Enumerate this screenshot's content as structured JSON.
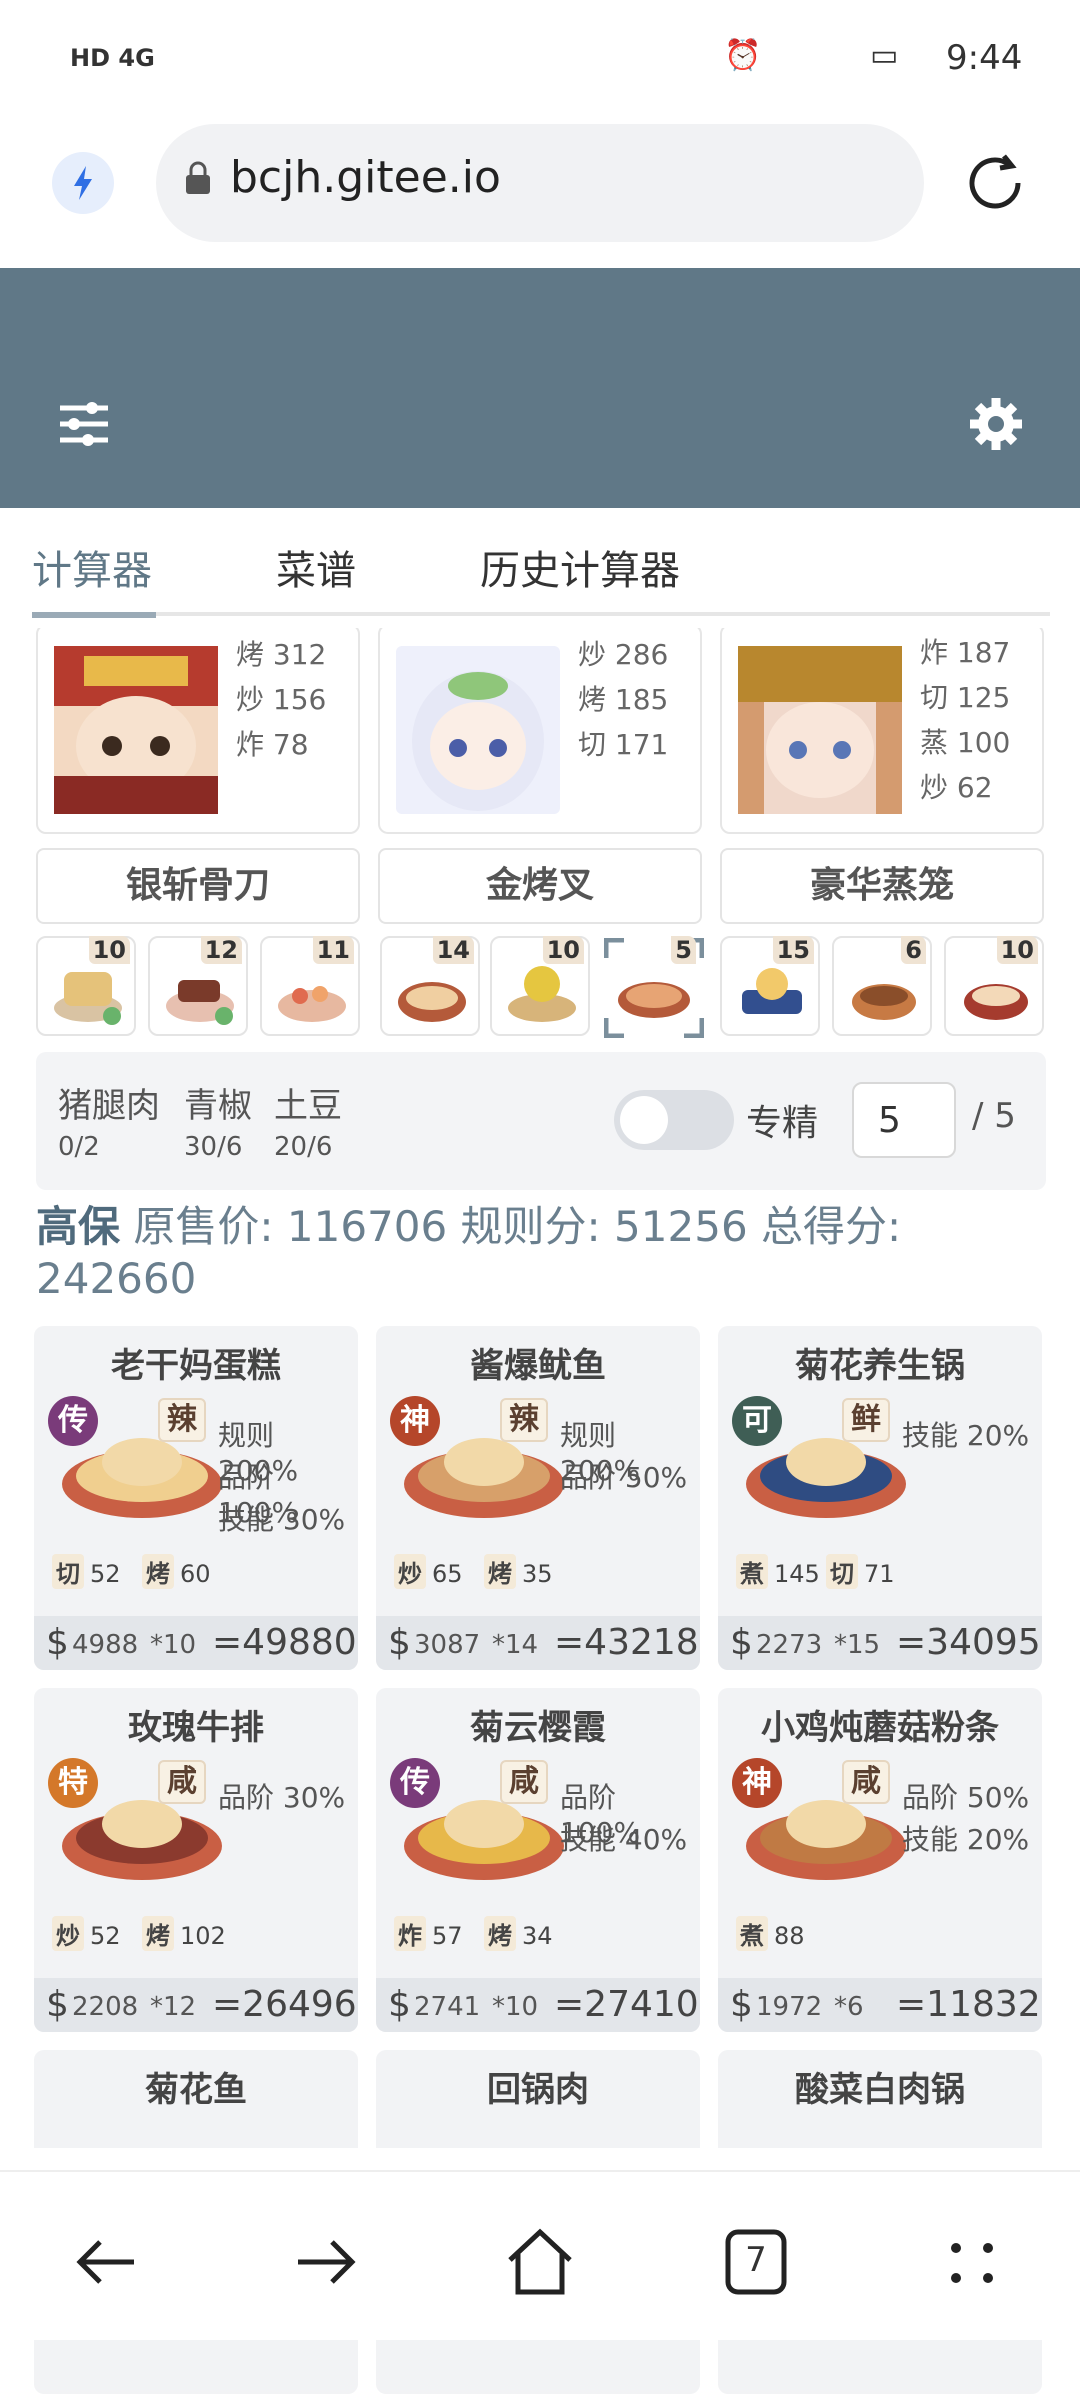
{
  "status": {
    "left": "HD 4G",
    "time": "9:44"
  },
  "url": "bcjh.gitee.io",
  "tabs": [
    "计算器",
    "菜谱",
    "历史计算器"
  ],
  "chefs": [
    {
      "skills": [
        "烤 312",
        "炒 156",
        "炸 78"
      ]
    },
    {
      "skills": [
        "炒 286",
        "烤 185",
        "切 171"
      ]
    },
    {
      "skills": [
        "炸 187",
        "切 125",
        "蒸 100",
        "炒 62"
      ]
    }
  ],
  "tools": [
    "银斩骨刀",
    "金烤叉",
    "豪华蒸笼"
  ],
  "slots": [
    "10",
    "12",
    "11",
    "14",
    "10",
    "5",
    "15",
    "6",
    "10"
  ],
  "ingredients": [
    {
      "name": "猪腿肉",
      "qty": "0/2"
    },
    {
      "name": "青椒",
      "qty": "30/6"
    },
    {
      "name": "土豆",
      "qty": "20/6"
    }
  ],
  "expert": {
    "label": "专精",
    "value": "5",
    "max": "/ 5"
  },
  "summary": {
    "dish": "高保",
    "line1": "原售价: 116706 规则分: 51256 总得分:",
    "line2": "242660"
  },
  "dishes": [
    {
      "name": "老干妈蛋糕",
      "rank": "传",
      "flavor": "辣",
      "bonus": [
        "规则 200%",
        "品阶 100%",
        "技能 30%"
      ],
      "skills": [
        [
          "切",
          "52"
        ],
        [
          "烤",
          "60"
        ]
      ],
      "price": "4988",
      "mult": "*10",
      "total": "=49880"
    },
    {
      "name": "酱爆鱿鱼",
      "rank": "神",
      "flavor": "辣",
      "bonus": [
        "规则 200%",
        "品阶 50%"
      ],
      "skills": [
        [
          "炒",
          "65"
        ],
        [
          "烤",
          "35"
        ]
      ],
      "price": "3087",
      "mult": "*14",
      "total": "=43218"
    },
    {
      "name": "菊花养生锅",
      "rank": "可",
      "flavor": "鲜",
      "bonus": [
        "技能 20%"
      ],
      "skills": [
        [
          "煮",
          "145"
        ],
        [
          "切",
          "71"
        ]
      ],
      "price": "2273",
      "mult": "*15",
      "total": "=34095"
    },
    {
      "name": "玫瑰牛排",
      "rank": "特",
      "flavor": "咸",
      "bonus": [
        "品阶 30%"
      ],
      "skills": [
        [
          "炒",
          "52"
        ],
        [
          "烤",
          "102"
        ]
      ],
      "price": "2208",
      "mult": "*12",
      "total": "=26496"
    },
    {
      "name": "菊云樱霞",
      "rank": "传",
      "flavor": "咸",
      "bonus": [
        "品阶 100%",
        "技能 40%"
      ],
      "skills": [
        [
          "炸",
          "57"
        ],
        [
          "烤",
          "34"
        ]
      ],
      "price": "2741",
      "mult": "*10",
      "total": "=27410"
    },
    {
      "name": "小鸡炖蘑菇粉条",
      "rank": "神",
      "flavor": "咸",
      "bonus": [
        "品阶 50%",
        "技能 20%"
      ],
      "skills": [
        [
          "煮",
          "88"
        ]
      ],
      "price": "1972",
      "mult": "*6",
      "total": "=11832"
    },
    {
      "name": "菊花鱼"
    },
    {
      "name": "回锅肉"
    },
    {
      "name": "酸菜白肉锅"
    }
  ],
  "nav": {
    "tab_count": "7"
  }
}
